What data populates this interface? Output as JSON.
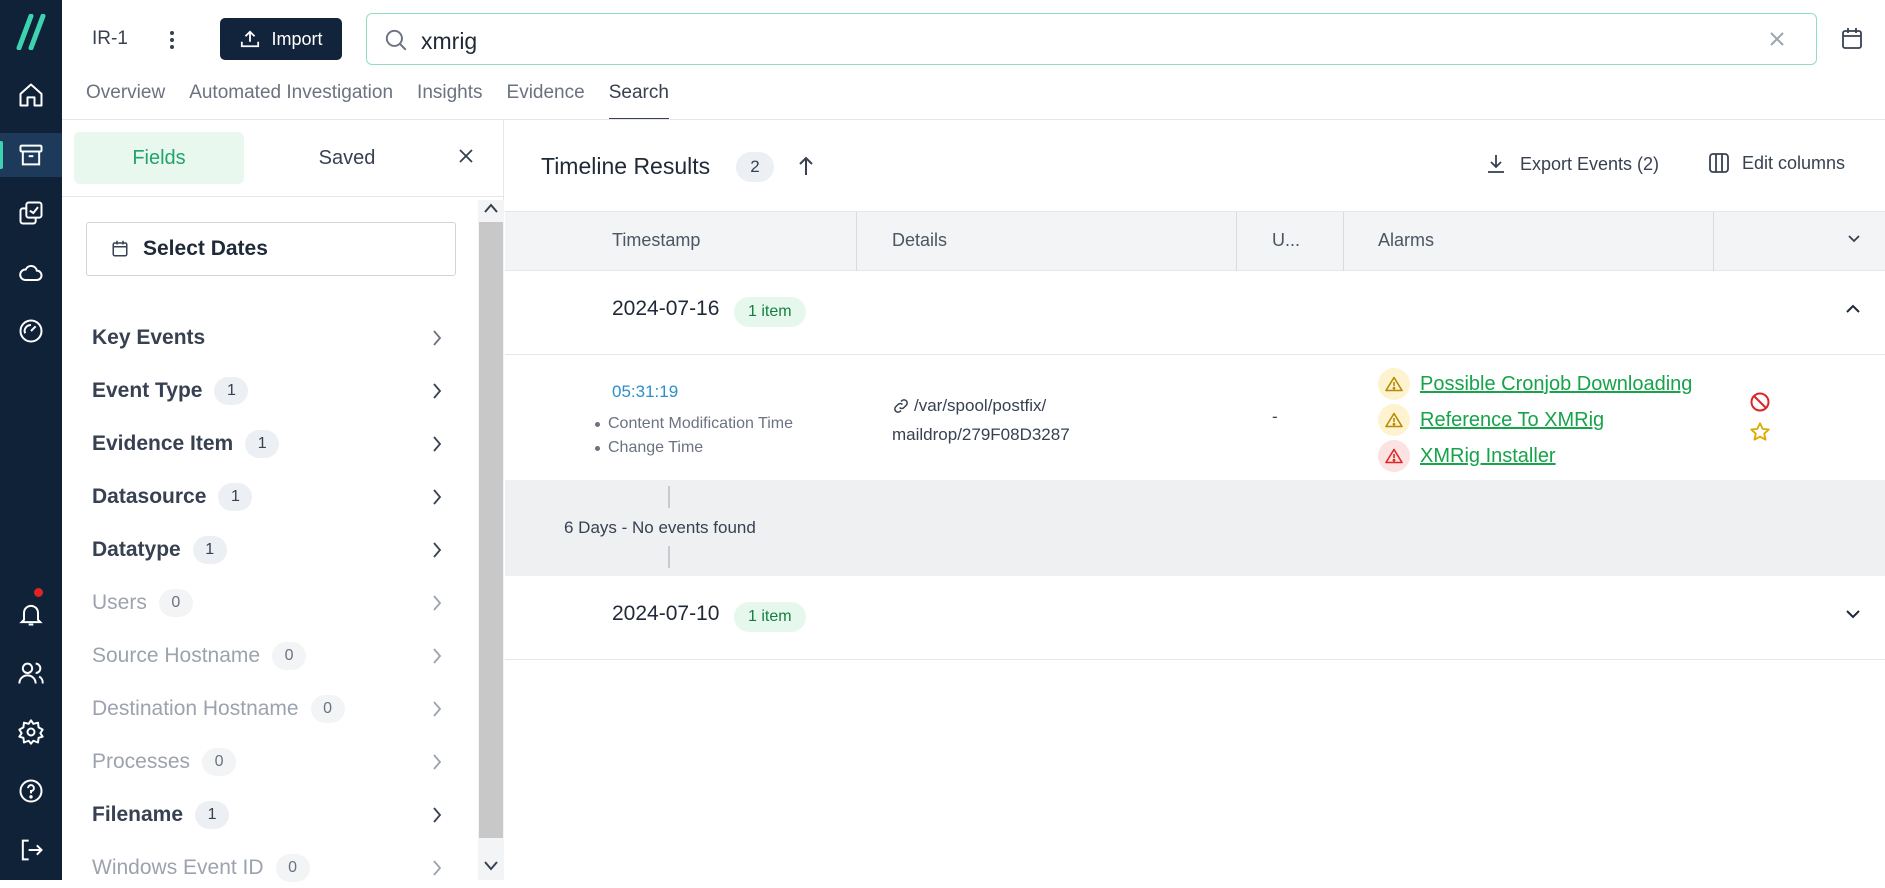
{
  "case": {
    "name": "IR-1"
  },
  "toolbar": {
    "import_label": "Import"
  },
  "search": {
    "value": "xmrig"
  },
  "tabs": [
    {
      "label": "Overview"
    },
    {
      "label": "Automated Investigation"
    },
    {
      "label": "Insights"
    },
    {
      "label": "Evidence"
    },
    {
      "label": "Search",
      "active": true
    }
  ],
  "fields_panel": {
    "fields_tab": "Fields",
    "saved_tab": "Saved",
    "select_dates": "Select Dates",
    "fields": [
      {
        "name": "Key Events",
        "count": ""
      },
      {
        "name": "Event Type",
        "count": "1"
      },
      {
        "name": "Evidence Item",
        "count": "1"
      },
      {
        "name": "Datasource",
        "count": "1"
      },
      {
        "name": "Datatype",
        "count": "1"
      },
      {
        "name": "Users",
        "count": "0"
      },
      {
        "name": "Source Hostname",
        "count": "0"
      },
      {
        "name": "Destination Hostname",
        "count": "0"
      },
      {
        "name": "Processes",
        "count": "0"
      },
      {
        "name": "Filename",
        "count": "1"
      },
      {
        "name": "Windows Event ID",
        "count": "0"
      }
    ]
  },
  "results": {
    "title": "Timeline Results",
    "count": "2",
    "export_label": "Export Events (2)",
    "edit_columns_label": "Edit columns",
    "columns": [
      "Timestamp",
      "Details",
      "U...",
      "Alarms"
    ],
    "groups": [
      {
        "date": "2024-07-16",
        "badge": "1 item",
        "expanded": true,
        "events": [
          {
            "time": "05:31:19",
            "types": [
              "Content Modification Time",
              "Change Time"
            ],
            "path_line1": "/var/spool/postfix/",
            "path_line2": "maildrop/279F08D3287",
            "user": "-",
            "alarms": [
              {
                "label": "Possible Cronjob Downloading",
                "severity": "warning"
              },
              {
                "label": "Reference To XMRig",
                "severity": "warning"
              },
              {
                "label": "XMRig Installer",
                "severity": "critical"
              }
            ]
          }
        ]
      },
      {
        "date": "2024-07-10",
        "badge": "1 item",
        "expanded": false
      }
    ],
    "gap_text": "6 Days - No events found"
  },
  "colors": {
    "accent": "#22a36b",
    "rail": "#0f2238",
    "link": "#2b8fc9",
    "warning": "#eab308",
    "critical": "#dc2626"
  }
}
